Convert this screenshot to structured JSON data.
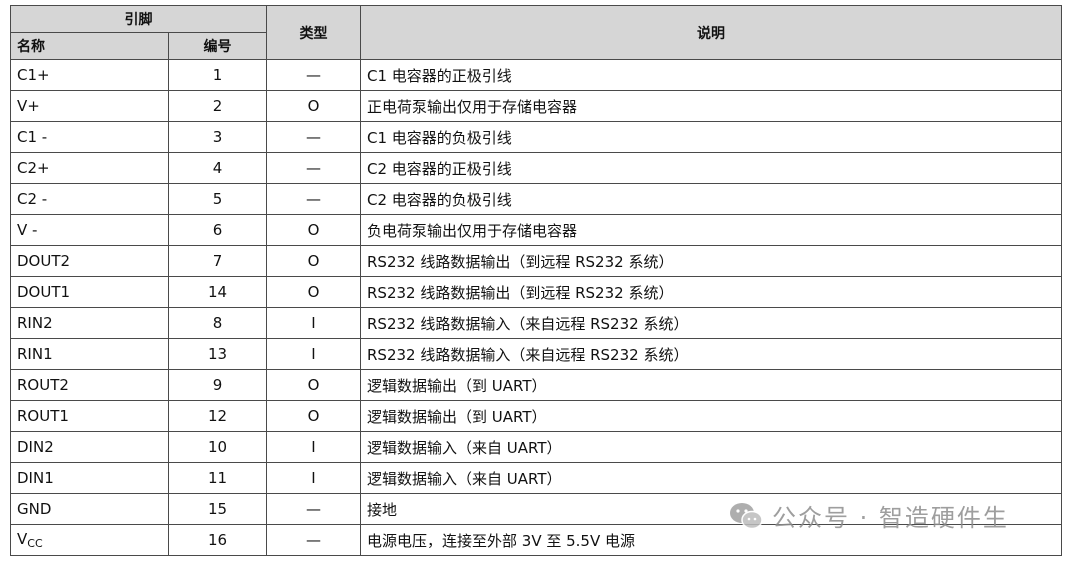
{
  "header": {
    "pin_group": "引脚",
    "name": "名称",
    "number": "编号",
    "type": "类型",
    "description": "说明"
  },
  "rows": [
    {
      "name": "C1+",
      "number": "1",
      "type": "—",
      "desc": "C1 电容器的正极引线"
    },
    {
      "name": "V+",
      "number": "2",
      "type": "O",
      "desc": "正电荷泵输出仅用于存储电容器"
    },
    {
      "name": "C1 -",
      "number": "3",
      "type": "—",
      "desc": "C1 电容器的负极引线"
    },
    {
      "name": "C2+",
      "number": "4",
      "type": "—",
      "desc": "C2 电容器的正极引线"
    },
    {
      "name": "C2 -",
      "number": "5",
      "type": "—",
      "desc": "C2 电容器的负极引线"
    },
    {
      "name": "V -",
      "number": "6",
      "type": "O",
      "desc": "负电荷泵输出仅用于存储电容器"
    },
    {
      "name": "DOUT2",
      "number": "7",
      "type": "O",
      "desc": "RS232 线路数据输出（到远程 RS232 系统）"
    },
    {
      "name": "DOUT1",
      "number": "14",
      "type": "O",
      "desc": "RS232 线路数据输出（到远程 RS232 系统）"
    },
    {
      "name": "RIN2",
      "number": "8",
      "type": "I",
      "desc": "RS232 线路数据输入（来自远程 RS232 系统）"
    },
    {
      "name": "RIN1",
      "number": "13",
      "type": "I",
      "desc": "RS232 线路数据输入（来自远程 RS232 系统）"
    },
    {
      "name": "ROUT2",
      "number": "9",
      "type": "O",
      "desc": "逻辑数据输出（到 UART）"
    },
    {
      "name": "ROUT1",
      "number": "12",
      "type": "O",
      "desc": "逻辑数据输出（到 UART）"
    },
    {
      "name": "DIN2",
      "number": "10",
      "type": "I",
      "desc": "逻辑数据输入（来自 UART）"
    },
    {
      "name": "DIN1",
      "number": "11",
      "type": "I",
      "desc": "逻辑数据输入（来自 UART）"
    },
    {
      "name": "GND",
      "number": "15",
      "type": "—",
      "desc": "接地"
    },
    {
      "name_main": "V",
      "name_sub": "CC",
      "number": "16",
      "type": "—",
      "desc": "电源电压，连接至外部 3V 至 5.5V 电源"
    }
  ],
  "watermark": {
    "icon": "wechat-icon",
    "text": "公众号 · 智造硬件生"
  }
}
